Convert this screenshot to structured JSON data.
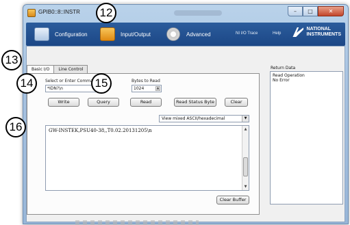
{
  "window": {
    "title": "GPIB0::8::INSTR"
  },
  "toolbar": {
    "configuration": "Configuration",
    "input_output": "Input/Output",
    "advanced": "Advanced",
    "ni_io_trace": "NI I/O Trace",
    "help": "Help",
    "logo_line1": "NATIONAL",
    "logo_line2": "INSTRUMENTS"
  },
  "tabs": [
    {
      "label": "Basic I/O",
      "active": true
    },
    {
      "label": "Line Control",
      "active": false
    }
  ],
  "basic_io": {
    "command_label": "Select or Enter Command",
    "command_value": "*IDN?\\n",
    "bytes_label": "Bytes to Read",
    "bytes_value": "1024",
    "buttons": {
      "write": "Write",
      "query": "Query",
      "read": "Read",
      "read_status": "Read Status Byte",
      "clear": "Clear",
      "clear_buffer": "Clear Buffer"
    },
    "view_mode": "View mixed ASCII/hexadecimal",
    "response": "GW-INSTEK,PSU40-38,,T0.02.20131205\\n"
  },
  "return_data": {
    "label": "Return Data",
    "lines": [
      "Read Operation",
      "No Error"
    ]
  },
  "callouts": {
    "c12": "12",
    "c13": "13",
    "c14": "14",
    "c15": "15",
    "c16": "16"
  },
  "icons": {
    "window_minimize": "minimize-icon",
    "window_maximize": "maximize-icon",
    "window_close": "close-icon",
    "configuration": "configuration-icon",
    "input_output": "input-output-icon",
    "advanced": "gear-icon",
    "ni_logo": "national-instruments-logo"
  }
}
